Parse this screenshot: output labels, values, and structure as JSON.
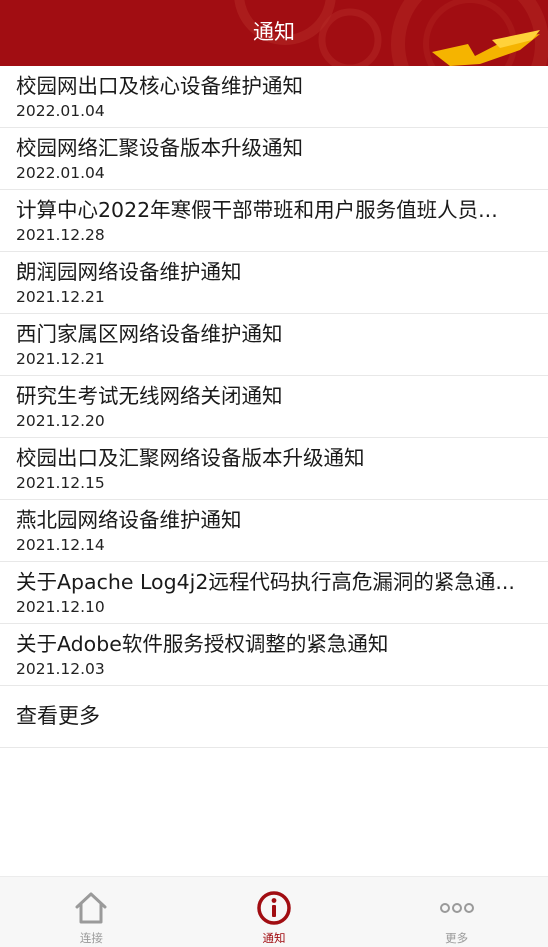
{
  "header": {
    "title": "通知"
  },
  "notices": [
    {
      "title": "校园网出口及核心设备维护通知",
      "date": "2022.01.04"
    },
    {
      "title": "校园网络汇聚设备版本升级通知",
      "date": "2022.01.04"
    },
    {
      "title": "计算中心2022年寒假干部带班和用户服务值班人员...",
      "date": "2021.12.28"
    },
    {
      "title": "朗润园网络设备维护通知",
      "date": "2021.12.21"
    },
    {
      "title": "西门家属区网络设备维护通知",
      "date": "2021.12.21"
    },
    {
      "title": "研究生考试无线网络关闭通知",
      "date": "2021.12.20"
    },
    {
      "title": "校园出口及汇聚网络设备版本升级通知",
      "date": "2021.12.15"
    },
    {
      "title": "燕北园网络设备维护通知",
      "date": "2021.12.14"
    },
    {
      "title": "关于Apache Log4j2远程代码执行高危漏洞的紧急通...",
      "date": "2021.12.10"
    },
    {
      "title": "关于Adobe软件服务授权调整的紧急通知",
      "date": "2021.12.03"
    }
  ],
  "more_label": "查看更多",
  "tabbar": {
    "tabs": [
      {
        "label": "连接",
        "icon": "home-icon",
        "active": false
      },
      {
        "label": "通知",
        "icon": "info-icon",
        "active": true
      },
      {
        "label": "更多",
        "icon": "more-dots-icon",
        "active": false
      }
    ]
  },
  "colors": {
    "brand": "#a10d12",
    "accent": "#f5b400",
    "inactive": "#9a9a9a"
  }
}
